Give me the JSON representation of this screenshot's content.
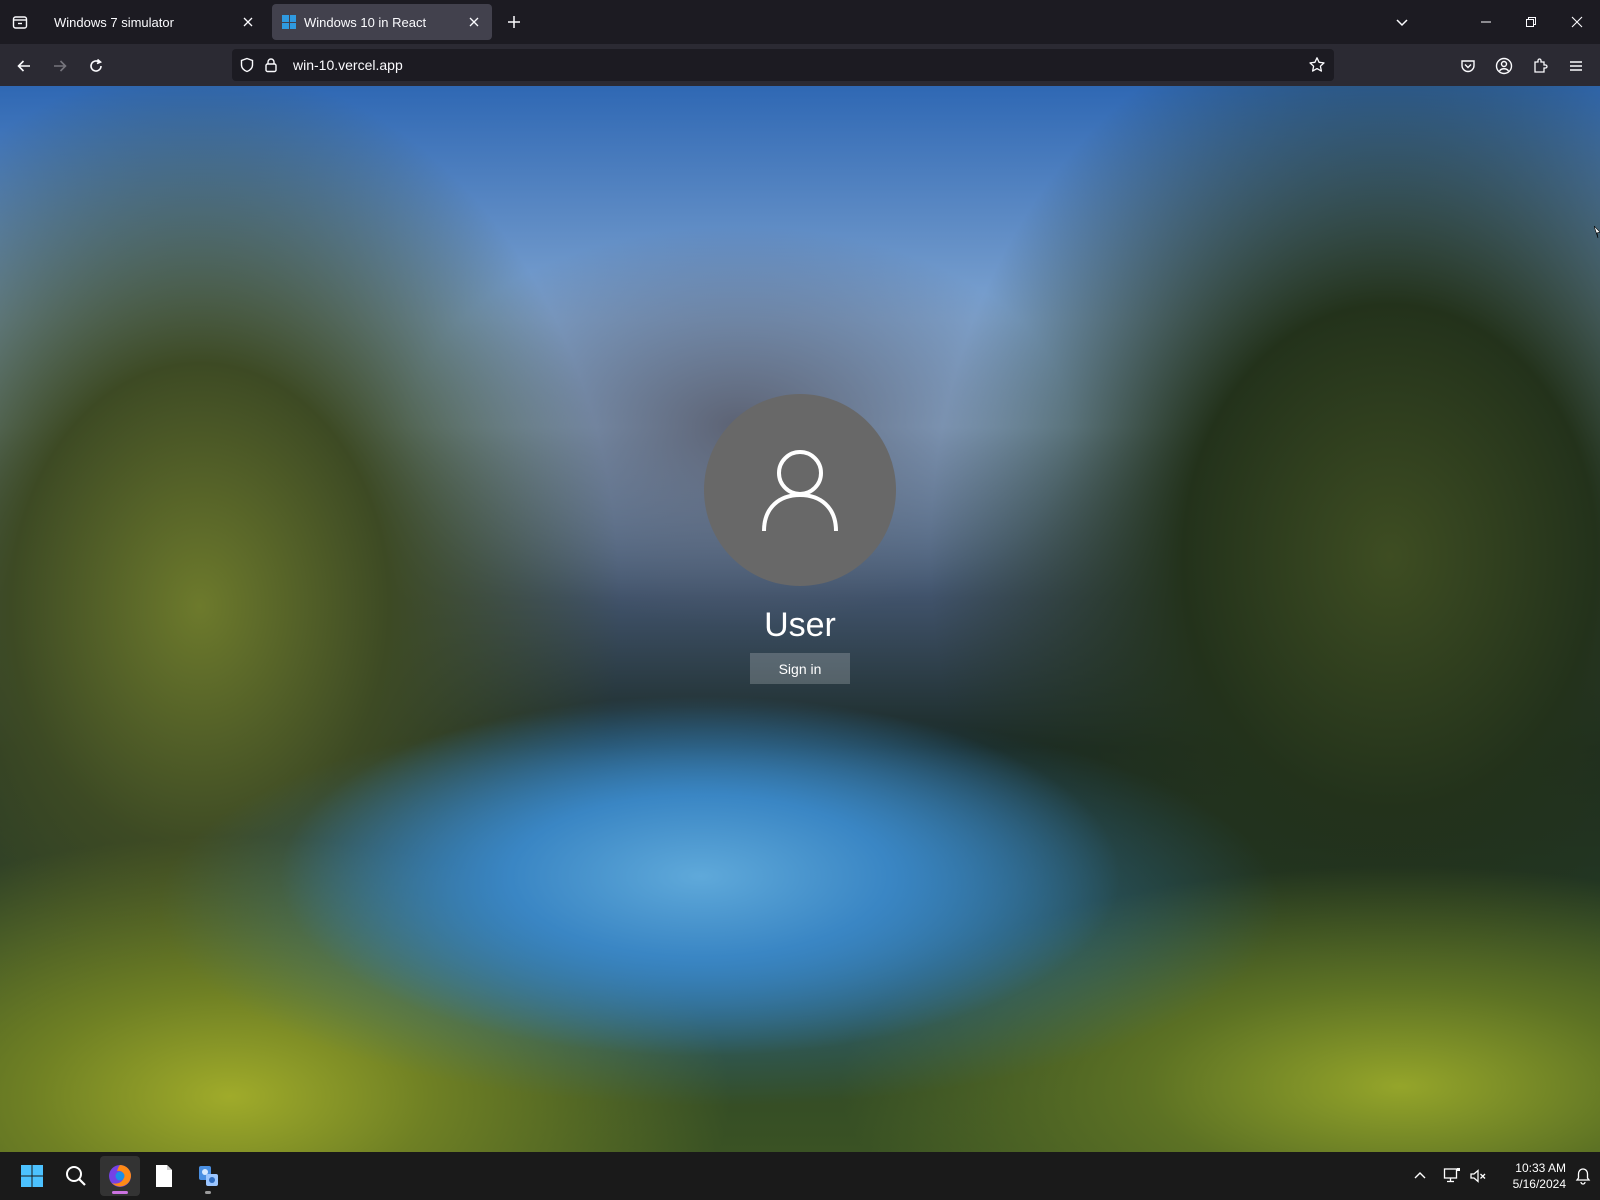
{
  "browser": {
    "tabs": [
      {
        "label": "Windows 7 simulator",
        "active": false
      },
      {
        "label": "Windows 10 in React",
        "active": true
      }
    ],
    "url": "win-10.vercel.app"
  },
  "login": {
    "username": "User",
    "signin_label": "Sign in"
  },
  "taskbar": {
    "time": "10:33 AM",
    "date": "5/16/2024"
  },
  "colors": {
    "browser_bg": "#1c1b22",
    "toolbar_bg": "#2b2a33",
    "active_tab_bg": "#42414d",
    "avatar_bg": "#686868",
    "taskbar_bg": "#1a1a1a",
    "active_app_indicator": "#cc73e1",
    "windows_blue": "#2f9ae0"
  },
  "icons": {
    "tabbar": [
      "tab-list-icon",
      "close-icon",
      "plus-icon",
      "chevron-down-icon",
      "minimize-icon",
      "restore-icon",
      "close-window-icon"
    ],
    "navbar": [
      "back-arrow-icon",
      "forward-arrow-icon",
      "reload-icon",
      "shield-icon",
      "lock-icon",
      "star-icon",
      "pocket-icon",
      "account-icon",
      "extensions-icon",
      "menu-icon"
    ],
    "taskbar": [
      "windows-start-icon",
      "search-icon",
      "firefox-icon",
      "file-icon",
      "app-icon",
      "chevron-up-icon",
      "network-icon",
      "volume-muted-icon",
      "notification-icon"
    ]
  }
}
